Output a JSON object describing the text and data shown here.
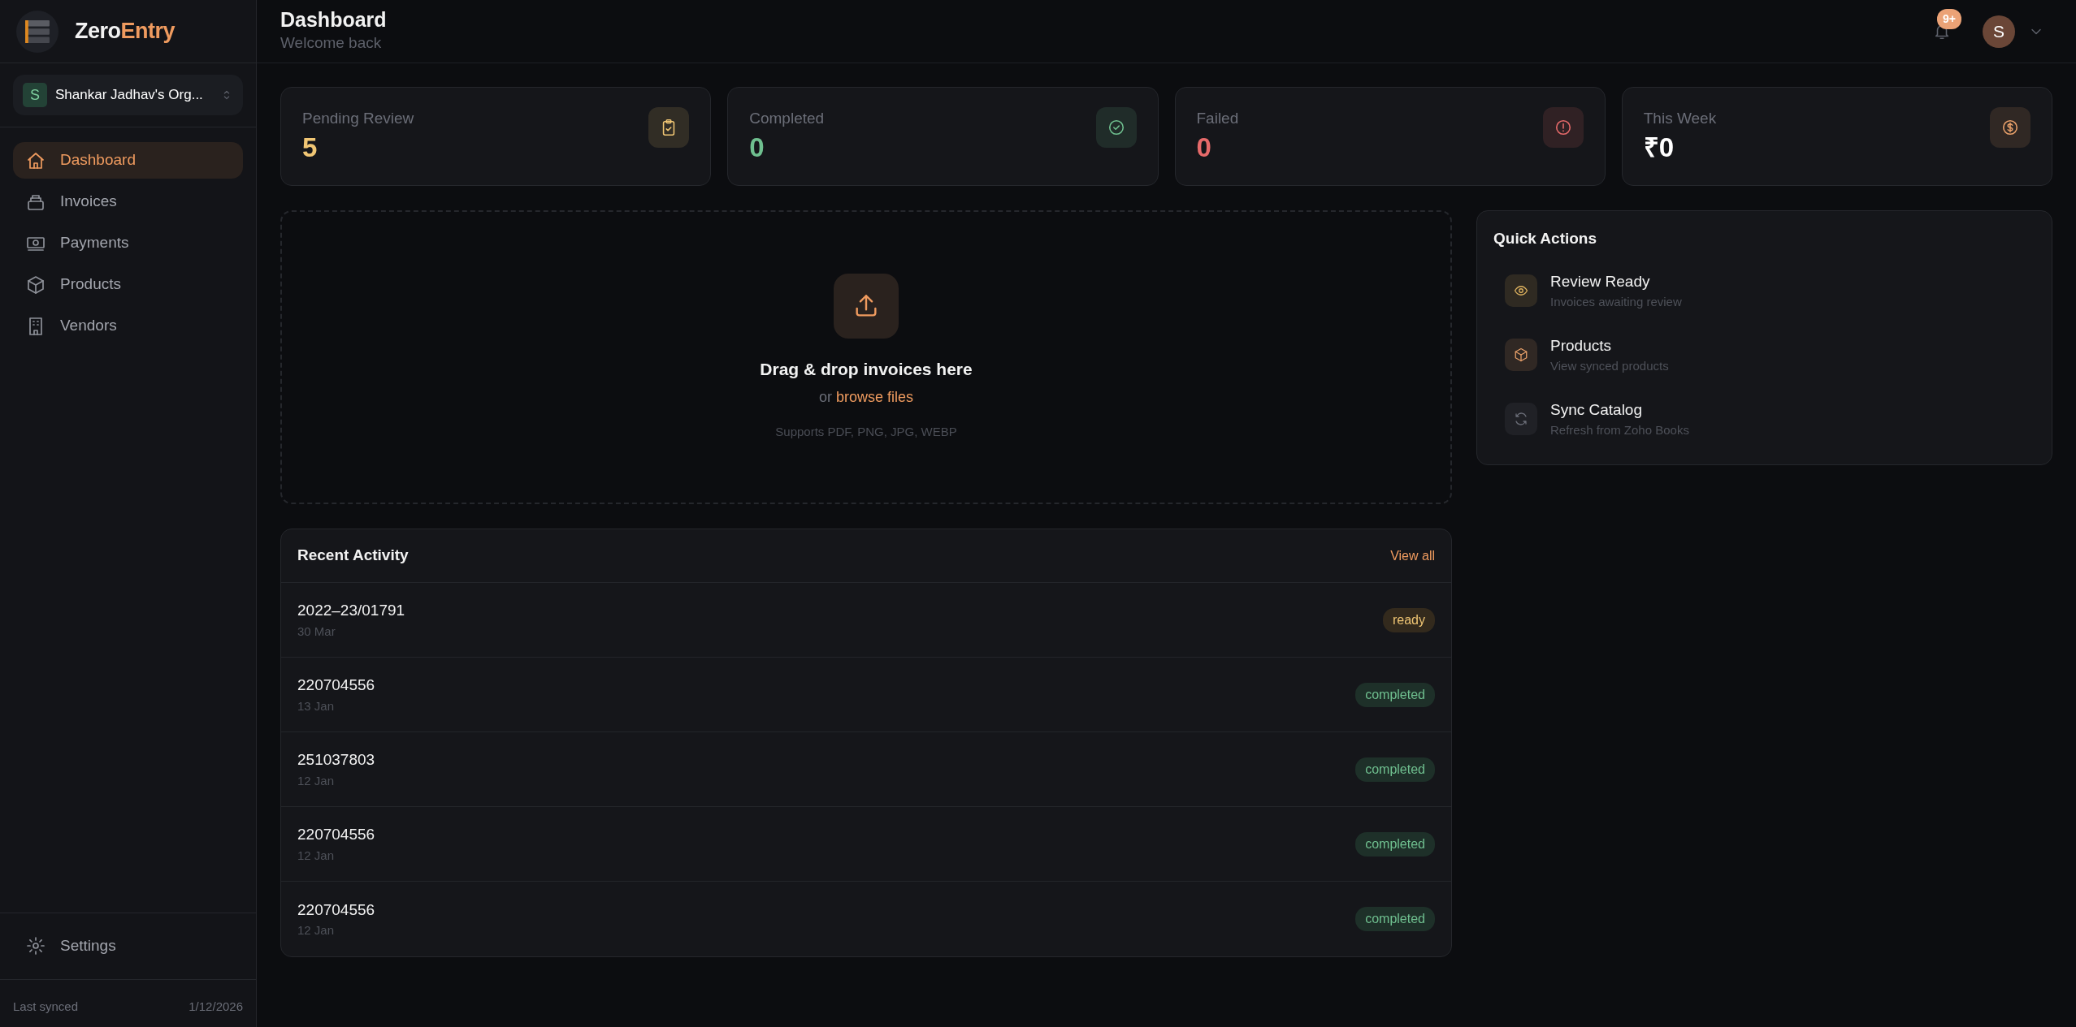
{
  "brand": {
    "first": "Zero",
    "second": "Entry"
  },
  "org": {
    "initial": "S",
    "name": "Shankar Jadhav's Org..."
  },
  "nav": [
    {
      "label": "Dashboard",
      "selected": true
    },
    {
      "label": "Invoices",
      "selected": false
    },
    {
      "label": "Payments",
      "selected": false
    },
    {
      "label": "Products",
      "selected": false
    },
    {
      "label": "Vendors",
      "selected": false
    }
  ],
  "settings": {
    "label": "Settings"
  },
  "sync": {
    "label": "Last synced",
    "date": "1/12/2026"
  },
  "header": {
    "title": "Dashboard",
    "subtitle": "Welcome back",
    "notification_count": "9+",
    "avatar": "S"
  },
  "stats": [
    {
      "label": "Pending Review",
      "value": "5",
      "color": "#f0c674"
    },
    {
      "label": "Completed",
      "value": "0",
      "color": "#6fbf8f"
    },
    {
      "label": "Failed",
      "value": "0",
      "color": "#e66a6a"
    },
    {
      "label": "This Week",
      "value": "₹0",
      "color": "#e8a06a"
    }
  ],
  "upload": {
    "title": "Drag & drop invoices here",
    "prefix": "or",
    "link": "browse files",
    "formats": "Supports PDF, PNG, JPG, WEBP"
  },
  "quick_actions": {
    "title": "Quick Actions",
    "items": [
      {
        "title": "Review Ready",
        "subtitle": "Invoices awaiting review",
        "color": "#e0b460"
      },
      {
        "title": "Products",
        "subtitle": "View synced products",
        "color": "#e8a06a"
      },
      {
        "title": "Sync Catalog",
        "subtitle": "Refresh from Zoho Books",
        "color": "#6b6e78"
      }
    ]
  },
  "recent_activity": {
    "title": "Recent Activity",
    "link": "View all",
    "rows": [
      {
        "id": "2022–23/01791",
        "date": "30 Mar",
        "status": "ready"
      },
      {
        "id": "220704556",
        "date": "13 Jan",
        "status": "completed"
      },
      {
        "id": "251037803",
        "date": "12 Jan",
        "status": "completed"
      },
      {
        "id": "220704556",
        "date": "12 Jan",
        "status": "completed"
      },
      {
        "id": "220704556",
        "date": "12 Jan",
        "status": "completed"
      }
    ]
  }
}
